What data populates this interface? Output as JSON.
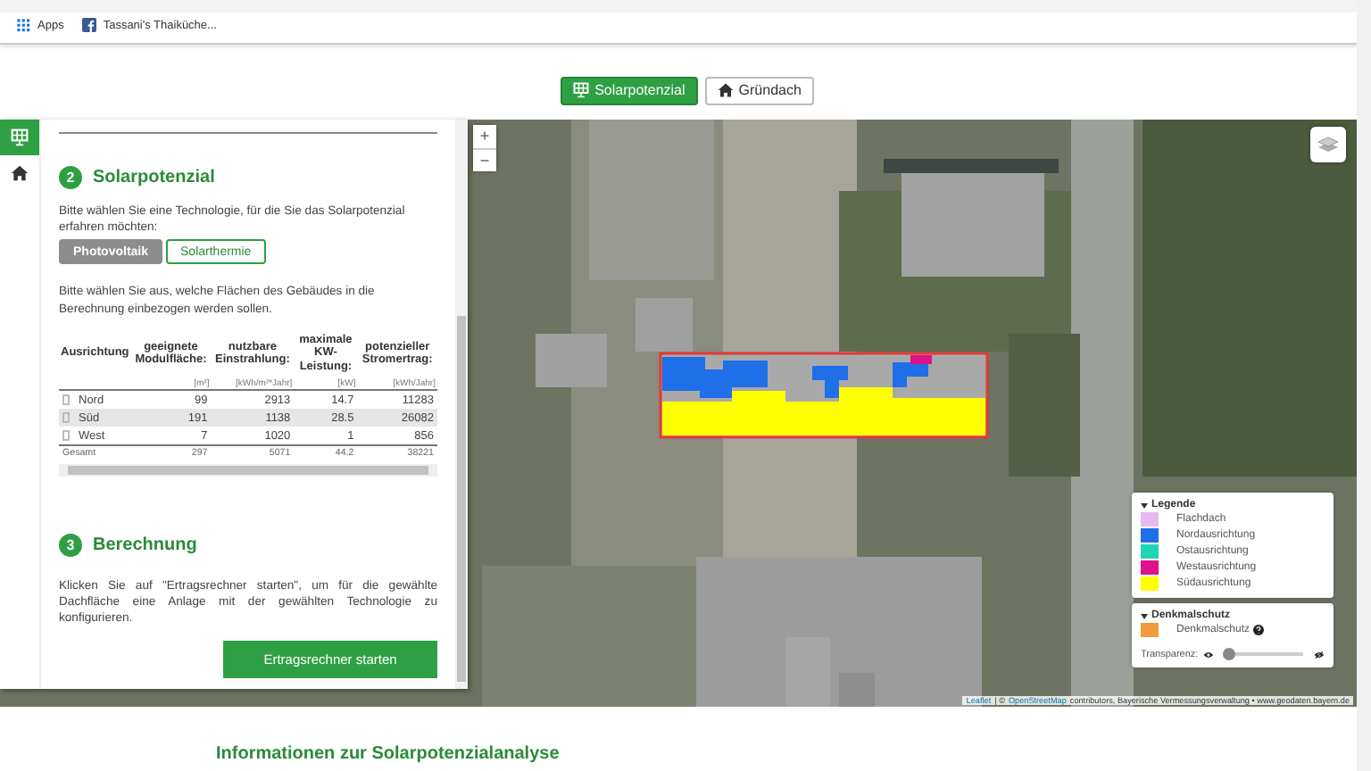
{
  "browser": {
    "bookmarks": [
      {
        "label": "Apps",
        "kind": "apps"
      },
      {
        "label": "Tassani's Thaiküche...",
        "kind": "facebook"
      }
    ]
  },
  "view_buttons": [
    {
      "label": "Solarpotenzial",
      "kind": "solar",
      "selected": true
    },
    {
      "label": "Gründach",
      "kind": "house",
      "selected": false
    }
  ],
  "sidebar": {
    "tabs": [
      {
        "kind": "solar",
        "selected": true
      },
      {
        "kind": "house",
        "selected": false
      }
    ],
    "step2": {
      "number": "2",
      "title": "Solarpotenzial",
      "intro": "Bitte wählen Sie eine Technologie, für die Sie das Solarpotenzial erfahren möchten:",
      "technologies": [
        {
          "label": "Photovoltaik",
          "selected": true
        },
        {
          "label": "Solarthermie",
          "selected": false
        }
      ],
      "surface_hint": "Bitte wählen Sie aus, welche Flächen des Gebäudes in die Berechnung einbezogen werden sollen.",
      "table": {
        "columns": [
          {
            "label": "Ausrichtung"
          },
          {
            "label": "geeignete Modulfläche:",
            "unit": "[m²]"
          },
          {
            "label": "nutzbare Einstrahlung:",
            "unit": "[kWh/m²*Jahr]"
          },
          {
            "label": "maximale KW-Leistung:",
            "unit": "[kW]"
          },
          {
            "label": "potenzieller Stromertrag:",
            "unit": "[kWh/Jahr]"
          }
        ],
        "rows": [
          {
            "cells": [
              "Nord",
              "99",
              "2913",
              "14.7",
              "11283"
            ],
            "checked": false,
            "selected": false
          },
          {
            "cells": [
              "Süd",
              "191",
              "1138",
              "28.5",
              "26082"
            ],
            "checked": false,
            "selected": true
          },
          {
            "cells": [
              "West",
              "7",
              "1020",
              "1",
              "856"
            ],
            "checked": false,
            "selected": false
          }
        ],
        "total": [
          "Gesamt",
          "297",
          "5071",
          "44.2",
          "38221"
        ]
      }
    },
    "step3": {
      "number": "3",
      "title": "Berechnung",
      "text": "Klicken Sie auf \"Ertragsrechner starten\", um für die gewählte Dachfläche eine Anlage mit der gewählten Technologie zu konfigurieren.",
      "button": "Ertragsrechner starten"
    }
  },
  "map": {
    "zoom": [
      "+",
      "−"
    ],
    "legend": {
      "title": "Legende",
      "expanded": true,
      "items": [
        {
          "label": "Flachdach",
          "color": "#e6b8f2"
        },
        {
          "label": "Nordausrichtung",
          "color": "#1f6fe8"
        },
        {
          "label": "Ostausrichtung",
          "color": "#1fd6b4"
        },
        {
          "label": "Westausrichtung",
          "color": "#e0118c"
        },
        {
          "label": "Südausrichtung",
          "color": "#ffff00"
        }
      ]
    },
    "heritage": {
      "title": "Denkmalschutz",
      "expanded": true,
      "items": [
        {
          "label": "Denkmalschutz",
          "color": "#f39a3c"
        }
      ],
      "transparency": {
        "label": "Transparenz:",
        "level": 0.05
      }
    },
    "attribution": [
      {
        "text": "Leaflet",
        "kind": "link"
      },
      {
        "text": "| ©",
        "kind": "plain"
      },
      {
        "text": "OpenStreetMap",
        "kind": "link"
      },
      {
        "text": "contributors, Bayerische Vermessungsverwaltung • www.geodaten.bayern.de",
        "kind": "plain"
      }
    ]
  },
  "footer": {
    "heading": "Informationen zur Solarpotenzialanalyse"
  }
}
